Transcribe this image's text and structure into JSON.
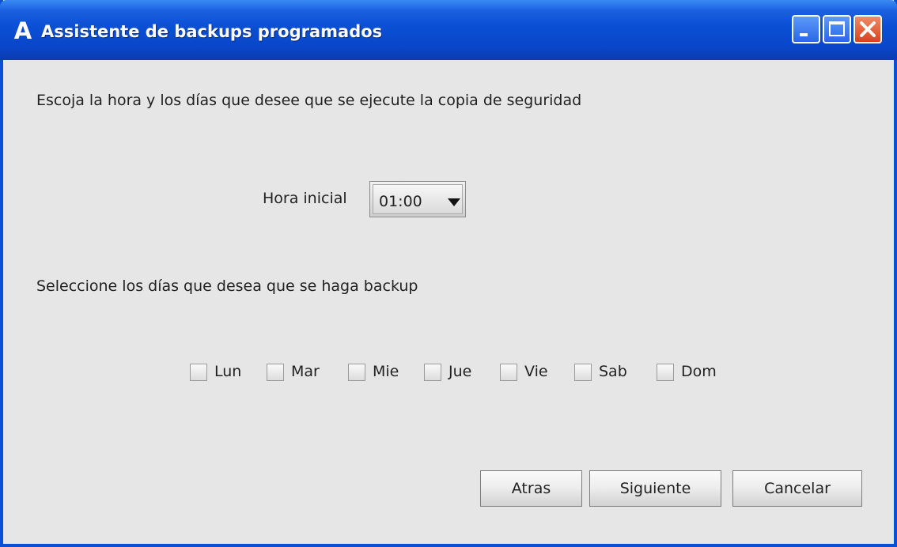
{
  "window": {
    "title": "Assistente de backups programados",
    "app_icon_letter": "A"
  },
  "instructions": {
    "time_prompt": "Escoja la hora y los días que desee que se ejecute la copia de seguridad",
    "days_prompt": "Seleccione los días que desea que se haga backup"
  },
  "start_time": {
    "label": "Hora inicial",
    "selected": "01:00"
  },
  "days": [
    {
      "label": "Lun",
      "checked": false
    },
    {
      "label": "Mar",
      "checked": false
    },
    {
      "label": "Mie",
      "checked": false
    },
    {
      "label": "Jue",
      "checked": false
    },
    {
      "label": "Vie",
      "checked": false
    },
    {
      "label": "Sab",
      "checked": false
    },
    {
      "label": "Dom",
      "checked": false
    }
  ],
  "buttons": {
    "back": "Atras",
    "next": "Siguiente",
    "cancel": "Cancelar"
  },
  "colors": {
    "titlebar": "#0a4fd4",
    "close_button": "#d8431c",
    "background": "#e6e6e6"
  }
}
